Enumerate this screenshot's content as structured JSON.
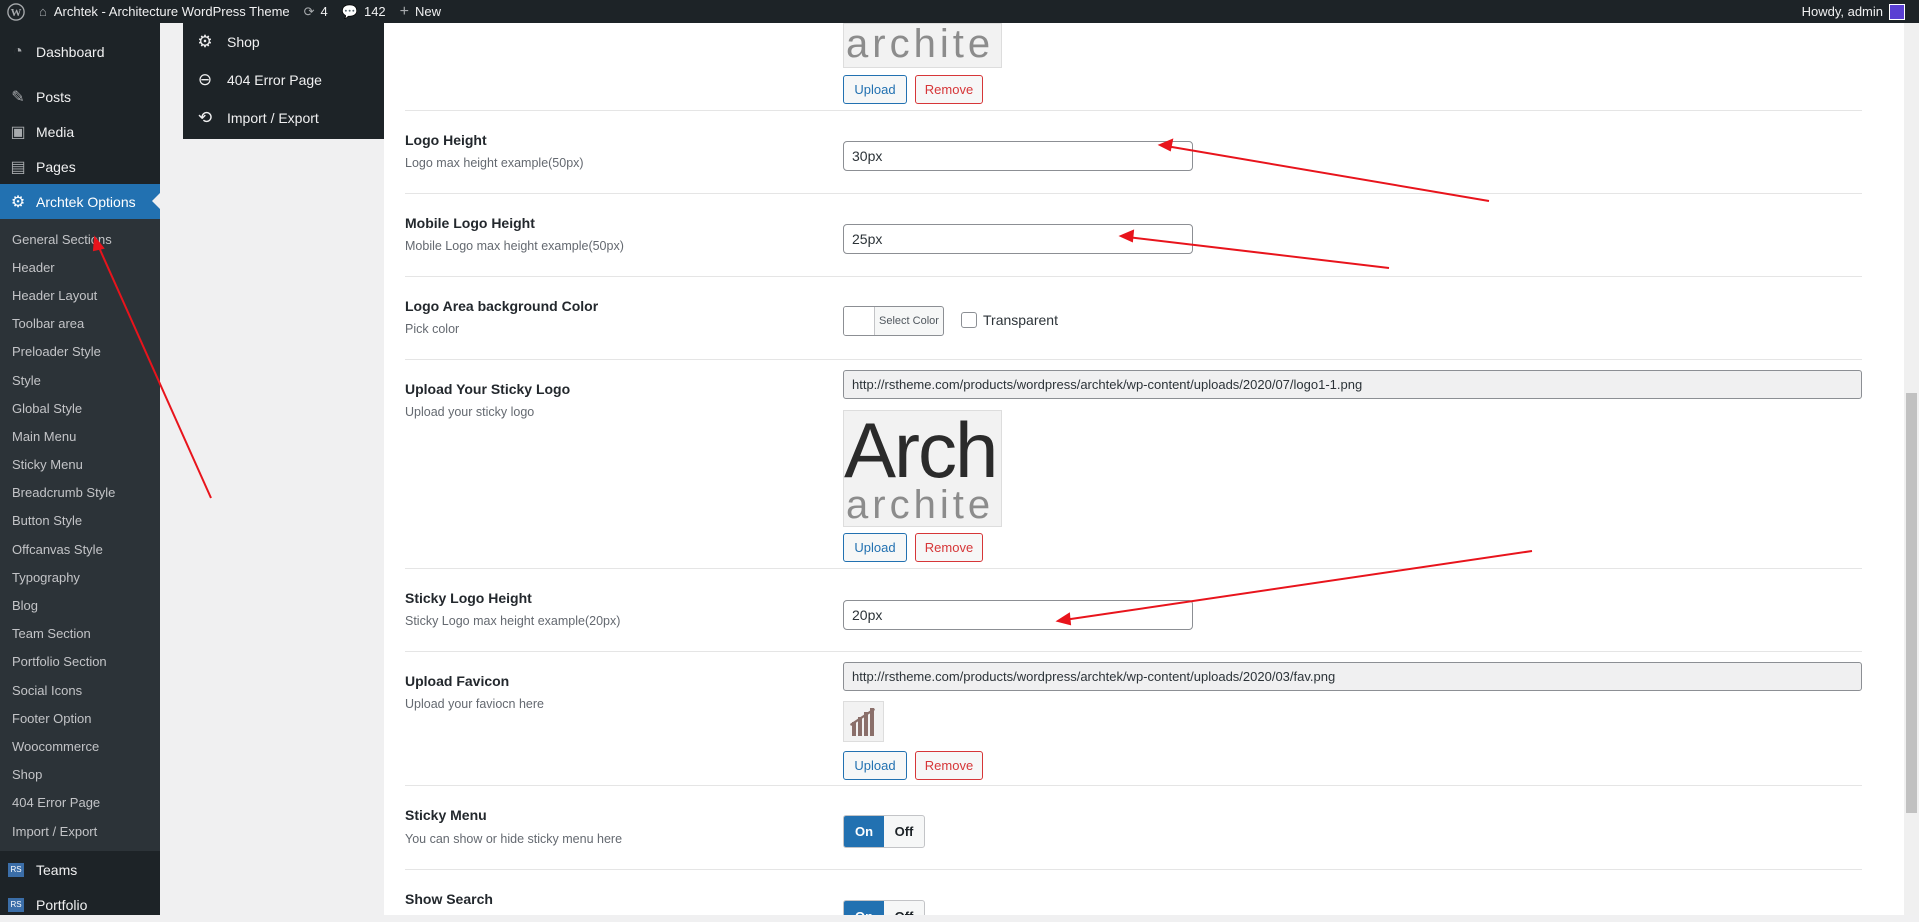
{
  "adminbar": {
    "site_title": "Archtek - Architecture WordPress Theme",
    "updates_count": "4",
    "comments_count": "142",
    "new_label": "New",
    "howdy": "Howdy, admin"
  },
  "sidebar": {
    "top_items": [
      {
        "label": "Dashboard",
        "icon": "dashboard-icon"
      },
      {
        "label": "Posts",
        "icon": "pin-icon"
      },
      {
        "label": "Media",
        "icon": "media-icon"
      },
      {
        "label": "Pages",
        "icon": "pages-icon"
      }
    ],
    "active_item": {
      "label": "Archtek Options",
      "icon": "gear-icon"
    },
    "sub_items": [
      "General Sections",
      "Header",
      "Header Layout",
      "Toolbar area",
      "Preloader Style",
      "Style",
      "Global Style",
      "Main Menu",
      "Sticky Menu",
      "Breadcrumb Style",
      "Button Style",
      "Offcanvas Style",
      "Typography",
      "Blog",
      "Team Section",
      "Portfolio Section",
      "Social Icons",
      "Footer Option",
      "Woocommerce",
      "Shop",
      "404 Error Page",
      "Import / Export"
    ],
    "bottom_items": [
      {
        "label": "Teams",
        "icon_text": "RS"
      },
      {
        "label": "Portfolio",
        "icon_text": "RS"
      }
    ]
  },
  "subpanel": {
    "items": [
      {
        "label": "Shop",
        "icon": "gear-icon"
      },
      {
        "label": "404 Error Page",
        "icon": "minus-circle-icon"
      },
      {
        "label": "Import / Export",
        "icon": "refresh-icon"
      }
    ]
  },
  "main": {
    "top_logo_small": "archite",
    "buttons": {
      "upload": "Upload",
      "remove": "Remove"
    },
    "logo_height": {
      "title": "Logo Height",
      "desc": "Logo max height example(50px)",
      "value": "30px"
    },
    "mobile_logo_height": {
      "title": "Mobile Logo Height",
      "desc": "Mobile Logo max height example(50px)",
      "value": "25px"
    },
    "logo_bg_color": {
      "title": "Logo Area background Color",
      "desc": "Pick color",
      "select_label": "Select Color",
      "transparent_label": "Transparent"
    },
    "sticky_logo": {
      "title": "Upload Your Sticky Logo",
      "desc": "Upload your sticky logo",
      "url": "http://rstheme.com/products/wordpress/archtek/wp-content/uploads/2020/07/logo1-1.png",
      "logo_big": "Arch",
      "logo_small": "archite"
    },
    "sticky_logo_height": {
      "title": "Sticky Logo Height",
      "desc": "Sticky Logo max height example(20px)",
      "value": "20px"
    },
    "favicon": {
      "title": "Upload Favicon",
      "desc": "Upload your faviocn here",
      "url": "http://rstheme.com/products/wordpress/archtek/wp-content/uploads/2020/03/fav.png"
    },
    "sticky_menu": {
      "title": "Sticky Menu",
      "desc": "You can show or hide sticky menu here",
      "on": "On",
      "off": "Off"
    },
    "show_search": {
      "title": "Show Search",
      "on": "On",
      "off": "Off"
    }
  },
  "colors": {
    "accent": "#2271b1",
    "danger": "#d63638",
    "arrow": "#e8141c",
    "admin_bg": "#1d2327"
  }
}
